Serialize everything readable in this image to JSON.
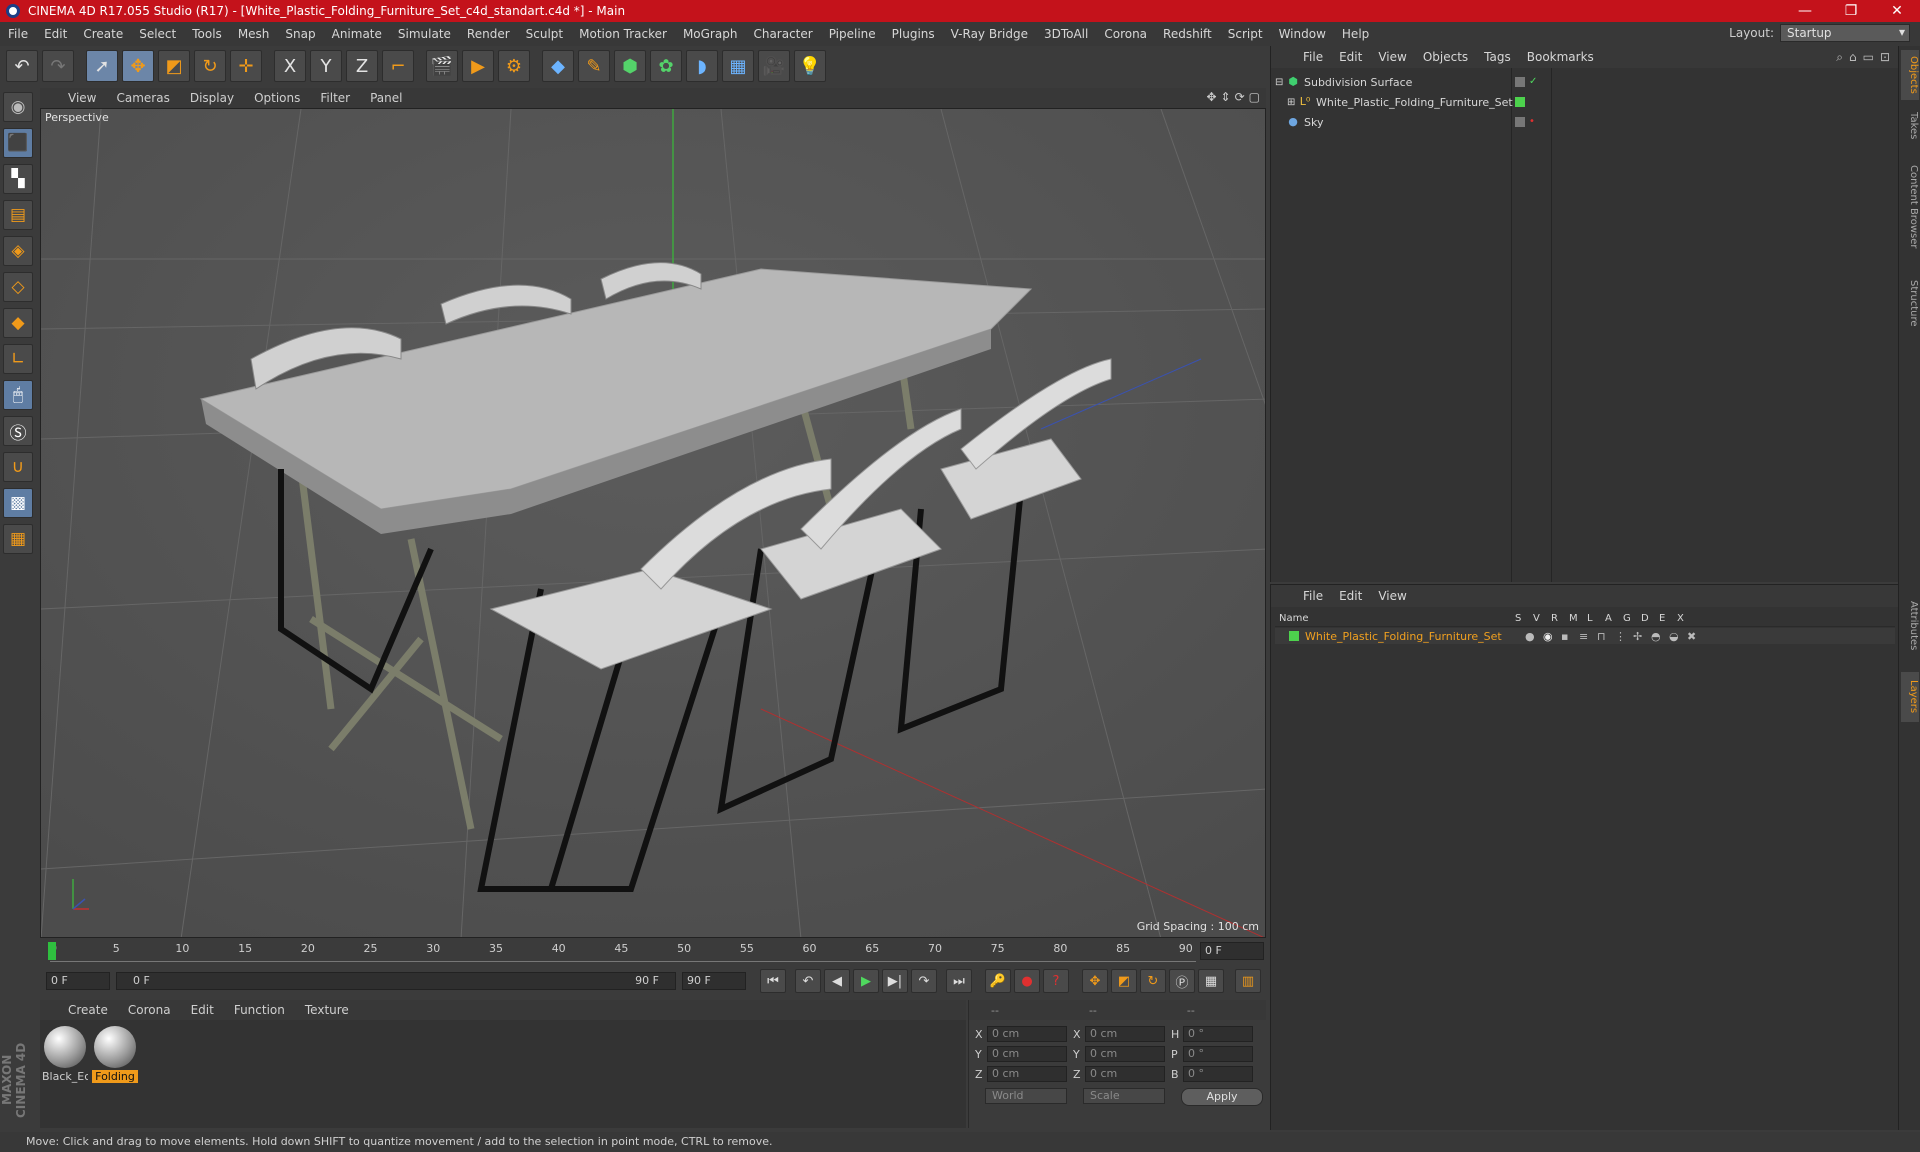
{
  "window": {
    "title": "CINEMA 4D R17.055 Studio (R17) - [White_Plastic_Folding_Furniture_Set_c4d_standart.c4d *] - Main",
    "minimize": "—",
    "maximize": "❐",
    "close": "✕"
  },
  "menubar": {
    "items": [
      "File",
      "Edit",
      "Create",
      "Select",
      "Tools",
      "Mesh",
      "Snap",
      "Animate",
      "Simulate",
      "Render",
      "Sculpt",
      "Motion Tracker",
      "MoGraph",
      "Character",
      "Pipeline",
      "Plugins",
      "V-Ray Bridge",
      "3DToAll",
      "Corona",
      "Redshift",
      "Script",
      "Window",
      "Help"
    ],
    "layout_label": "Layout:",
    "layout_value": "Startup"
  },
  "toolbar": {
    "icons": [
      "undo-icon",
      "redo-icon",
      "select-icon",
      "move-icon",
      "scale-icon",
      "rotate-icon",
      "live-select-icon",
      "x-axis-icon",
      "y-axis-icon",
      "z-axis-icon",
      "coord-system-icon",
      "render-view-icon",
      "render-picture-viewer-icon",
      "render-settings-icon",
      "cube-icon",
      "pen-icon",
      "subdivision-icon",
      "array-icon",
      "deformer-icon",
      "floor-icon",
      "camera-icon",
      "light-icon"
    ],
    "axis_x": "X",
    "axis_y": "Y",
    "axis_z": "Z"
  },
  "viewport": {
    "menu": [
      "View",
      "Cameras",
      "Display",
      "Options",
      "Filter",
      "Panel"
    ],
    "label": "Perspective",
    "grid_spacing": "Grid Spacing : 100 cm",
    "nav_icons": [
      "move-view-icon",
      "zoom-view-icon",
      "rotate-view-icon",
      "toggle-view-icon"
    ]
  },
  "timeline": {
    "ticks": [
      "0",
      "5",
      "10",
      "15",
      "20",
      "25",
      "30",
      "35",
      "40",
      "45",
      "50",
      "55",
      "60",
      "65",
      "70",
      "75",
      "80",
      "85",
      "90"
    ],
    "current_frame": "0 F",
    "start_frame": "0 F",
    "range_start": "0 F",
    "range_end": "90 F",
    "end_frame": "90 F"
  },
  "materials": {
    "menu": [
      "Create",
      "Corona",
      "Edit",
      "Function",
      "Texture"
    ],
    "items": [
      {
        "name": "Black_Ec",
        "selected": false
      },
      {
        "name": "Folding",
        "selected": true
      }
    ]
  },
  "coords": {
    "header": [
      "--",
      "--",
      "--"
    ],
    "rows": [
      {
        "a1": "X",
        "v1": "0 cm",
        "a2": "X",
        "v2": "0 cm",
        "a3": "H",
        "v3": "0 °"
      },
      {
        "a1": "Y",
        "v1": "0 cm",
        "a2": "Y",
        "v2": "0 cm",
        "a3": "P",
        "v3": "0 °"
      },
      {
        "a1": "Z",
        "v1": "0 cm",
        "a2": "Z",
        "v2": "0 cm",
        "a3": "B",
        "v3": "0 °"
      }
    ],
    "world": "World",
    "scale": "Scale",
    "apply": "Apply"
  },
  "object_manager": {
    "menu": [
      "File",
      "Edit",
      "View",
      "Objects",
      "Tags",
      "Bookmarks"
    ],
    "objects": [
      {
        "name": "Subdivision Surface",
        "icon": "subdivision-icon",
        "expander": "⊟",
        "color": "#3fcf6f"
      },
      {
        "name": "White_Plastic_Folding_Furniture_Set",
        "icon": "null-object-icon",
        "expander": "⊞",
        "color": "#f0c040"
      },
      {
        "name": "Sky",
        "icon": "sky-icon",
        "expander": "",
        "color": "#6ea6e0"
      }
    ]
  },
  "layer_manager": {
    "menu": [
      "File",
      "Edit",
      "View"
    ],
    "columns": [
      "Name",
      "S",
      "V",
      "R",
      "M",
      "L",
      "A",
      "G",
      "D",
      "E",
      "X"
    ],
    "layers": [
      {
        "name": "White_Plastic_Folding_Furniture_Set",
        "color": "#4dd24d"
      }
    ]
  },
  "right_tabs": [
    "Objects",
    "Takes",
    "Content Browser",
    "Structure",
    "Attributes",
    "Layers"
  ],
  "status": "Move: Click and drag to move elements. Hold down SHIFT to quantize movement / add to the selection in point mode, CTRL to remove.",
  "logo": "MAXON CINEMA 4D"
}
